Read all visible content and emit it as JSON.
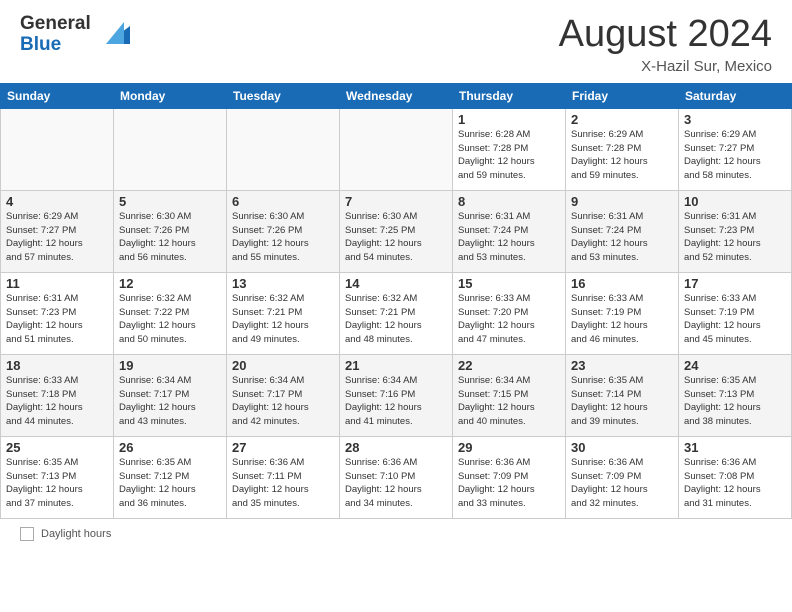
{
  "logo": {
    "general": "General",
    "blue": "Blue"
  },
  "title": {
    "month_year": "August 2024",
    "location": "X-Hazil Sur, Mexico"
  },
  "days_of_week": [
    "Sunday",
    "Monday",
    "Tuesday",
    "Wednesday",
    "Thursday",
    "Friday",
    "Saturday"
  ],
  "weeks": [
    [
      {
        "day": "",
        "info": ""
      },
      {
        "day": "",
        "info": ""
      },
      {
        "day": "",
        "info": ""
      },
      {
        "day": "",
        "info": ""
      },
      {
        "day": "1",
        "info": "Sunrise: 6:28 AM\nSunset: 7:28 PM\nDaylight: 12 hours\nand 59 minutes."
      },
      {
        "day": "2",
        "info": "Sunrise: 6:29 AM\nSunset: 7:28 PM\nDaylight: 12 hours\nand 59 minutes."
      },
      {
        "day": "3",
        "info": "Sunrise: 6:29 AM\nSunset: 7:27 PM\nDaylight: 12 hours\nand 58 minutes."
      }
    ],
    [
      {
        "day": "4",
        "info": "Sunrise: 6:29 AM\nSunset: 7:27 PM\nDaylight: 12 hours\nand 57 minutes."
      },
      {
        "day": "5",
        "info": "Sunrise: 6:30 AM\nSunset: 7:26 PM\nDaylight: 12 hours\nand 56 minutes."
      },
      {
        "day": "6",
        "info": "Sunrise: 6:30 AM\nSunset: 7:26 PM\nDaylight: 12 hours\nand 55 minutes."
      },
      {
        "day": "7",
        "info": "Sunrise: 6:30 AM\nSunset: 7:25 PM\nDaylight: 12 hours\nand 54 minutes."
      },
      {
        "day": "8",
        "info": "Sunrise: 6:31 AM\nSunset: 7:24 PM\nDaylight: 12 hours\nand 53 minutes."
      },
      {
        "day": "9",
        "info": "Sunrise: 6:31 AM\nSunset: 7:24 PM\nDaylight: 12 hours\nand 53 minutes."
      },
      {
        "day": "10",
        "info": "Sunrise: 6:31 AM\nSunset: 7:23 PM\nDaylight: 12 hours\nand 52 minutes."
      }
    ],
    [
      {
        "day": "11",
        "info": "Sunrise: 6:31 AM\nSunset: 7:23 PM\nDaylight: 12 hours\nand 51 minutes."
      },
      {
        "day": "12",
        "info": "Sunrise: 6:32 AM\nSunset: 7:22 PM\nDaylight: 12 hours\nand 50 minutes."
      },
      {
        "day": "13",
        "info": "Sunrise: 6:32 AM\nSunset: 7:21 PM\nDaylight: 12 hours\nand 49 minutes."
      },
      {
        "day": "14",
        "info": "Sunrise: 6:32 AM\nSunset: 7:21 PM\nDaylight: 12 hours\nand 48 minutes."
      },
      {
        "day": "15",
        "info": "Sunrise: 6:33 AM\nSunset: 7:20 PM\nDaylight: 12 hours\nand 47 minutes."
      },
      {
        "day": "16",
        "info": "Sunrise: 6:33 AM\nSunset: 7:19 PM\nDaylight: 12 hours\nand 46 minutes."
      },
      {
        "day": "17",
        "info": "Sunrise: 6:33 AM\nSunset: 7:19 PM\nDaylight: 12 hours\nand 45 minutes."
      }
    ],
    [
      {
        "day": "18",
        "info": "Sunrise: 6:33 AM\nSunset: 7:18 PM\nDaylight: 12 hours\nand 44 minutes."
      },
      {
        "day": "19",
        "info": "Sunrise: 6:34 AM\nSunset: 7:17 PM\nDaylight: 12 hours\nand 43 minutes."
      },
      {
        "day": "20",
        "info": "Sunrise: 6:34 AM\nSunset: 7:17 PM\nDaylight: 12 hours\nand 42 minutes."
      },
      {
        "day": "21",
        "info": "Sunrise: 6:34 AM\nSunset: 7:16 PM\nDaylight: 12 hours\nand 41 minutes."
      },
      {
        "day": "22",
        "info": "Sunrise: 6:34 AM\nSunset: 7:15 PM\nDaylight: 12 hours\nand 40 minutes."
      },
      {
        "day": "23",
        "info": "Sunrise: 6:35 AM\nSunset: 7:14 PM\nDaylight: 12 hours\nand 39 minutes."
      },
      {
        "day": "24",
        "info": "Sunrise: 6:35 AM\nSunset: 7:13 PM\nDaylight: 12 hours\nand 38 minutes."
      }
    ],
    [
      {
        "day": "25",
        "info": "Sunrise: 6:35 AM\nSunset: 7:13 PM\nDaylight: 12 hours\nand 37 minutes."
      },
      {
        "day": "26",
        "info": "Sunrise: 6:35 AM\nSunset: 7:12 PM\nDaylight: 12 hours\nand 36 minutes."
      },
      {
        "day": "27",
        "info": "Sunrise: 6:36 AM\nSunset: 7:11 PM\nDaylight: 12 hours\nand 35 minutes."
      },
      {
        "day": "28",
        "info": "Sunrise: 6:36 AM\nSunset: 7:10 PM\nDaylight: 12 hours\nand 34 minutes."
      },
      {
        "day": "29",
        "info": "Sunrise: 6:36 AM\nSunset: 7:09 PM\nDaylight: 12 hours\nand 33 minutes."
      },
      {
        "day": "30",
        "info": "Sunrise: 6:36 AM\nSunset: 7:09 PM\nDaylight: 12 hours\nand 32 minutes."
      },
      {
        "day": "31",
        "info": "Sunrise: 6:36 AM\nSunset: 7:08 PM\nDaylight: 12 hours\nand 31 minutes."
      }
    ]
  ],
  "footer": {
    "daylight_label": "Daylight hours"
  }
}
